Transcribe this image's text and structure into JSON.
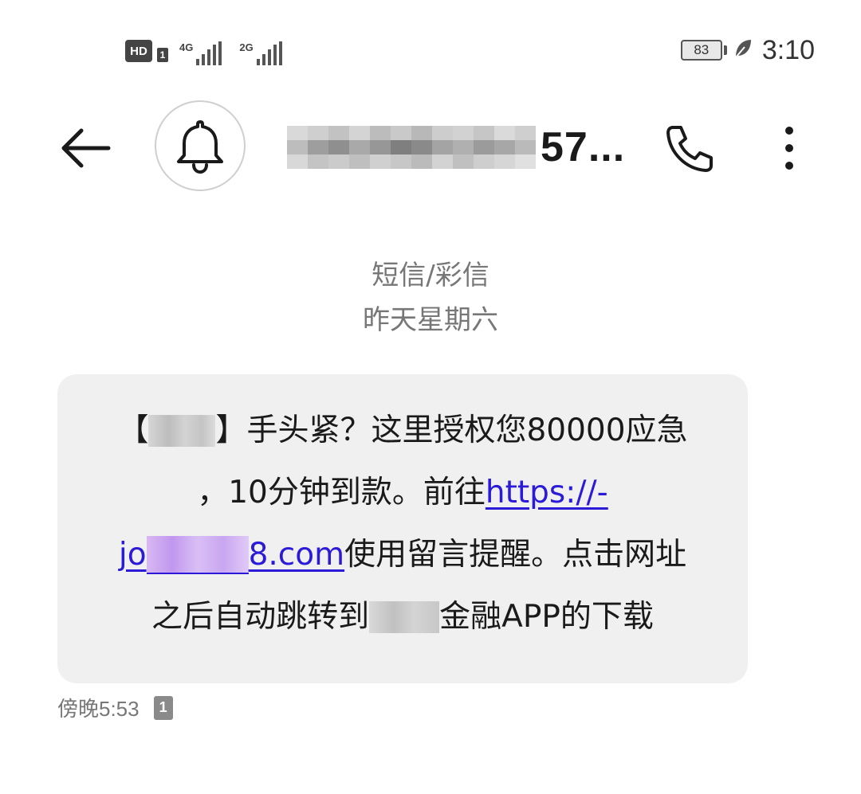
{
  "status_bar": {
    "hd_label": "HD",
    "sim1_label": "1",
    "net1_label": "4G",
    "net2_label": "2G",
    "battery_level": "83",
    "time": "3:10",
    "icons": [
      "hd-icon",
      "signal-4g-icon",
      "signal-2g-icon",
      "battery-icon",
      "eco-leaf-icon"
    ]
  },
  "header": {
    "contact_visible_suffix": "57...",
    "icons": [
      "back-arrow-icon",
      "bell-icon",
      "phone-icon",
      "more-vertical-icon"
    ]
  },
  "thread": {
    "type_label": "短信/彩信",
    "date_label": "昨天星期六"
  },
  "message": {
    "line1_open": "【",
    "line1_close": "】手头紧？这里授权您80000应急",
    "line2_text": "，10分钟到款。前往",
    "line2_link": "https://-",
    "line3_link_start": "jo",
    "line3_link_end": "8.com",
    "line3_text": "使用留言提醒。点击网址",
    "line4_text_start": "之后自动跳转到",
    "line4_text_end": "金融APP的下载",
    "link_color": "#2b1bd8"
  },
  "footer": {
    "timestamp": "傍晚5:53",
    "sim_badge": "1"
  },
  "colors": {
    "bubble_bg": "#f0f0f0",
    "meta_text": "#777777",
    "primary_text": "#1a1a1a"
  }
}
